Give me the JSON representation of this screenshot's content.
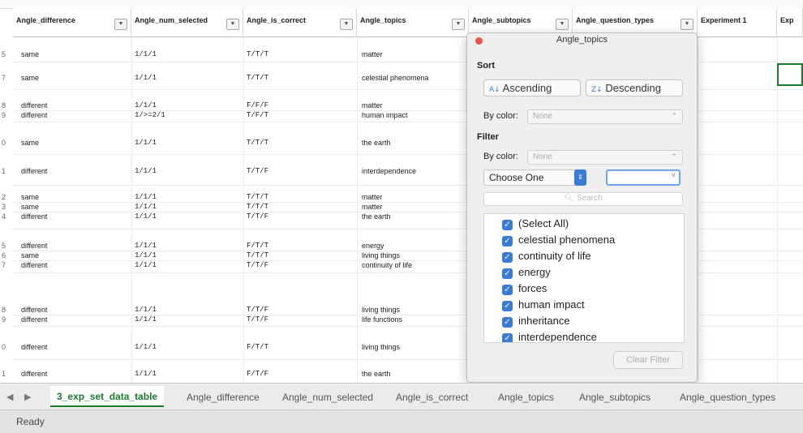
{
  "columns": [
    {
      "label": "Angle_difference"
    },
    {
      "label": "Angle_num_selected"
    },
    {
      "label": "Angle_is_correct"
    },
    {
      "label": "Angle_topics"
    },
    {
      "label": "Angle_subtopics"
    },
    {
      "label": "Angle_question_types"
    },
    {
      "label": "Experiment 1"
    },
    {
      "label": "Exp"
    }
  ],
  "filter_icon": "chevron-down-icon",
  "rows": [
    {
      "num": "5",
      "diff": "same",
      "sel": "1/1/1",
      "corr": "T/T/T",
      "topic": "matter"
    },
    {
      "num": "7",
      "diff": "same",
      "sel": "1/1/1",
      "corr": "T/T/T",
      "topic": "celestial phenomena"
    },
    {
      "num": "8",
      "diff": "different",
      "sel": "1/1/1",
      "corr": "F/F/F",
      "topic": "matter"
    },
    {
      "num": "9",
      "diff": "different",
      "sel": "1/>=2/1",
      "corr": "T/F/T",
      "topic": "human impact"
    },
    {
      "num": "0",
      "diff": "same",
      "sel": "1/1/1",
      "corr": "T/T/T",
      "topic": "the earth"
    },
    {
      "num": "1",
      "diff": "different",
      "sel": "1/1/1",
      "corr": "T/T/F",
      "topic": "interdependence"
    },
    {
      "num": "2",
      "diff": "same",
      "sel": "1/1/1",
      "corr": "T/T/T",
      "topic": "matter"
    },
    {
      "num": "3",
      "diff": "same",
      "sel": "1/1/1",
      "corr": "T/T/T",
      "topic": "matter"
    },
    {
      "num": "4",
      "diff": "different",
      "sel": "1/1/1",
      "corr": "T/T/F",
      "topic": "the earth"
    },
    {
      "num": "5",
      "diff": "different",
      "sel": "1/1/1",
      "corr": "F/T/T",
      "topic": "energy"
    },
    {
      "num": "6",
      "diff": "same",
      "sel": "1/1/1",
      "corr": "T/T/T",
      "topic": "living things"
    },
    {
      "num": "7",
      "diff": "different",
      "sel": "1/1/1",
      "corr": "T/T/F",
      "topic": "continuity of life"
    },
    {
      "num": "8",
      "diff": "different",
      "sel": "1/1/1",
      "corr": "T/T/F",
      "topic": "living things"
    },
    {
      "num": "9",
      "diff": "different",
      "sel": "1/1/1",
      "corr": "T/T/F",
      "topic": "life functions"
    },
    {
      "num": "0",
      "diff": "different",
      "sel": "1/1/1",
      "corr": "F/T/T",
      "topic": "living things"
    },
    {
      "num": "1",
      "diff": "different",
      "sel": "1/1/1",
      "corr": "F/T/F",
      "topic": "the earth"
    }
  ],
  "popup": {
    "title": "Angle_topics",
    "sort_heading": "Sort",
    "ascending": "Ascending",
    "descending": "Descending",
    "by_color": "By color:",
    "none": "None",
    "filter_heading": "Filter",
    "choose_one": "Choose One",
    "search_placeholder": "Search",
    "items": [
      "(Select All)",
      "celestial phenomena",
      "continuity of life",
      "energy",
      "forces",
      "human impact",
      "inheritance",
      "interdependence"
    ],
    "clear_filter": "Clear Filter"
  },
  "tabs": [
    "3_exp_set_data_table",
    "Angle_difference",
    "Angle_num_selected",
    "Angle_is_correct",
    "Angle_topics",
    "Angle_subtopics",
    "Angle_question_types"
  ],
  "status": "Ready",
  "colors": {
    "accent": "#3a7bd5",
    "active_tab": "#1b7a2e",
    "close": "#e9534a"
  }
}
